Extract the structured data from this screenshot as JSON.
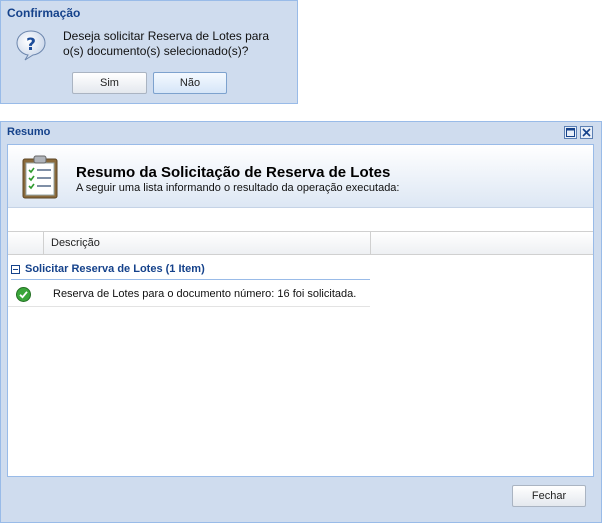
{
  "confirm": {
    "title": "Confirmação",
    "message": "Deseja solicitar Reserva de Lotes para o(s) documento(s) selecionado(s)?",
    "yes_label": "Sim",
    "no_label": "Não",
    "icon": "question-icon"
  },
  "resumo": {
    "window_title": "Resumo",
    "tools": [
      "maximize-icon",
      "close-icon"
    ],
    "header_title": "Resumo da Solicitação de Reserva de Lotes",
    "header_subtitle": "A seguir uma lista informando o resultado da operação executada:",
    "header_icon": "clipboard-checklist-icon",
    "grid": {
      "columns": [
        "",
        "Descrição",
        ""
      ],
      "group_label": "Solicitar Reserva de Lotes (1 Item)",
      "rows": [
        {
          "status": "success",
          "icon": "check-circle-icon",
          "text": "Reserva de Lotes para o documento número: 16 foi solicitada."
        }
      ]
    },
    "close_label": "Fechar"
  },
  "colors": {
    "panel_bg": "#cfdcee",
    "border": "#99bbe8",
    "title_blue": "#15428b",
    "success_green": "#3aa63a"
  }
}
